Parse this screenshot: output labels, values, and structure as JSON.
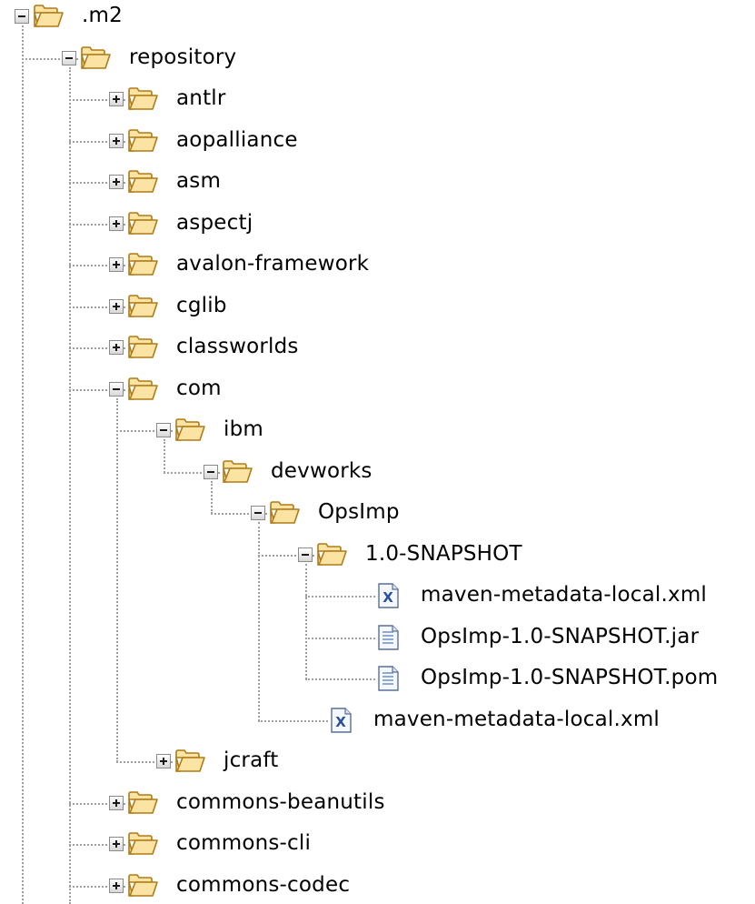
{
  "tree": {
    "root": {
      "label": ".m2",
      "expanded": true,
      "children": [
        {
          "label": "repository",
          "expanded": true,
          "children": [
            {
              "label": "antlr",
              "expanded": false
            },
            {
              "label": "aopalliance",
              "expanded": false
            },
            {
              "label": "asm",
              "expanded": false
            },
            {
              "label": "aspectj",
              "expanded": false
            },
            {
              "label": "avalon-framework",
              "expanded": false
            },
            {
              "label": "cglib",
              "expanded": false
            },
            {
              "label": "classworlds",
              "expanded": false
            },
            {
              "label": "com",
              "expanded": true,
              "children": [
                {
                  "label": "ibm",
                  "expanded": true,
                  "children": [
                    {
                      "label": "devworks",
                      "expanded": true,
                      "children": [
                        {
                          "label": "OpsImp",
                          "expanded": true,
                          "children": [
                            {
                              "label": "1.0-SNAPSHOT",
                              "expanded": true,
                              "children": [
                                {
                                  "label": "maven-metadata-local.xml",
                                  "file": "xml-file-icon"
                                },
                                {
                                  "label": "OpsImp-1.0-SNAPSHOT.jar",
                                  "file": "text-file-icon"
                                },
                                {
                                  "label": "OpsImp-1.0-SNAPSHOT.pom",
                                  "file": "text-file-icon"
                                }
                              ]
                            },
                            {
                              "label": "maven-metadata-local.xml",
                              "file": "xml-file-icon"
                            }
                          ]
                        }
                      ]
                    }
                  ]
                },
                {
                  "label": "jcraft",
                  "expanded": false
                }
              ]
            },
            {
              "label": "commons-beanutils",
              "expanded": false
            },
            {
              "label": "commons-cli",
              "expanded": false
            },
            {
              "label": "commons-codec",
              "expanded": false
            }
          ]
        }
      ]
    }
  },
  "icons": {
    "folder": "open-folder-icon",
    "expand": "plus-icon",
    "collapse": "minus-icon"
  },
  "colors": {
    "folder_fill": "#fbe3a3",
    "folder_stroke": "#b07b18",
    "connector": "#a0a0a0",
    "xml_accent": "#2a4f9e",
    "file_lines": "#6f8fc0"
  }
}
